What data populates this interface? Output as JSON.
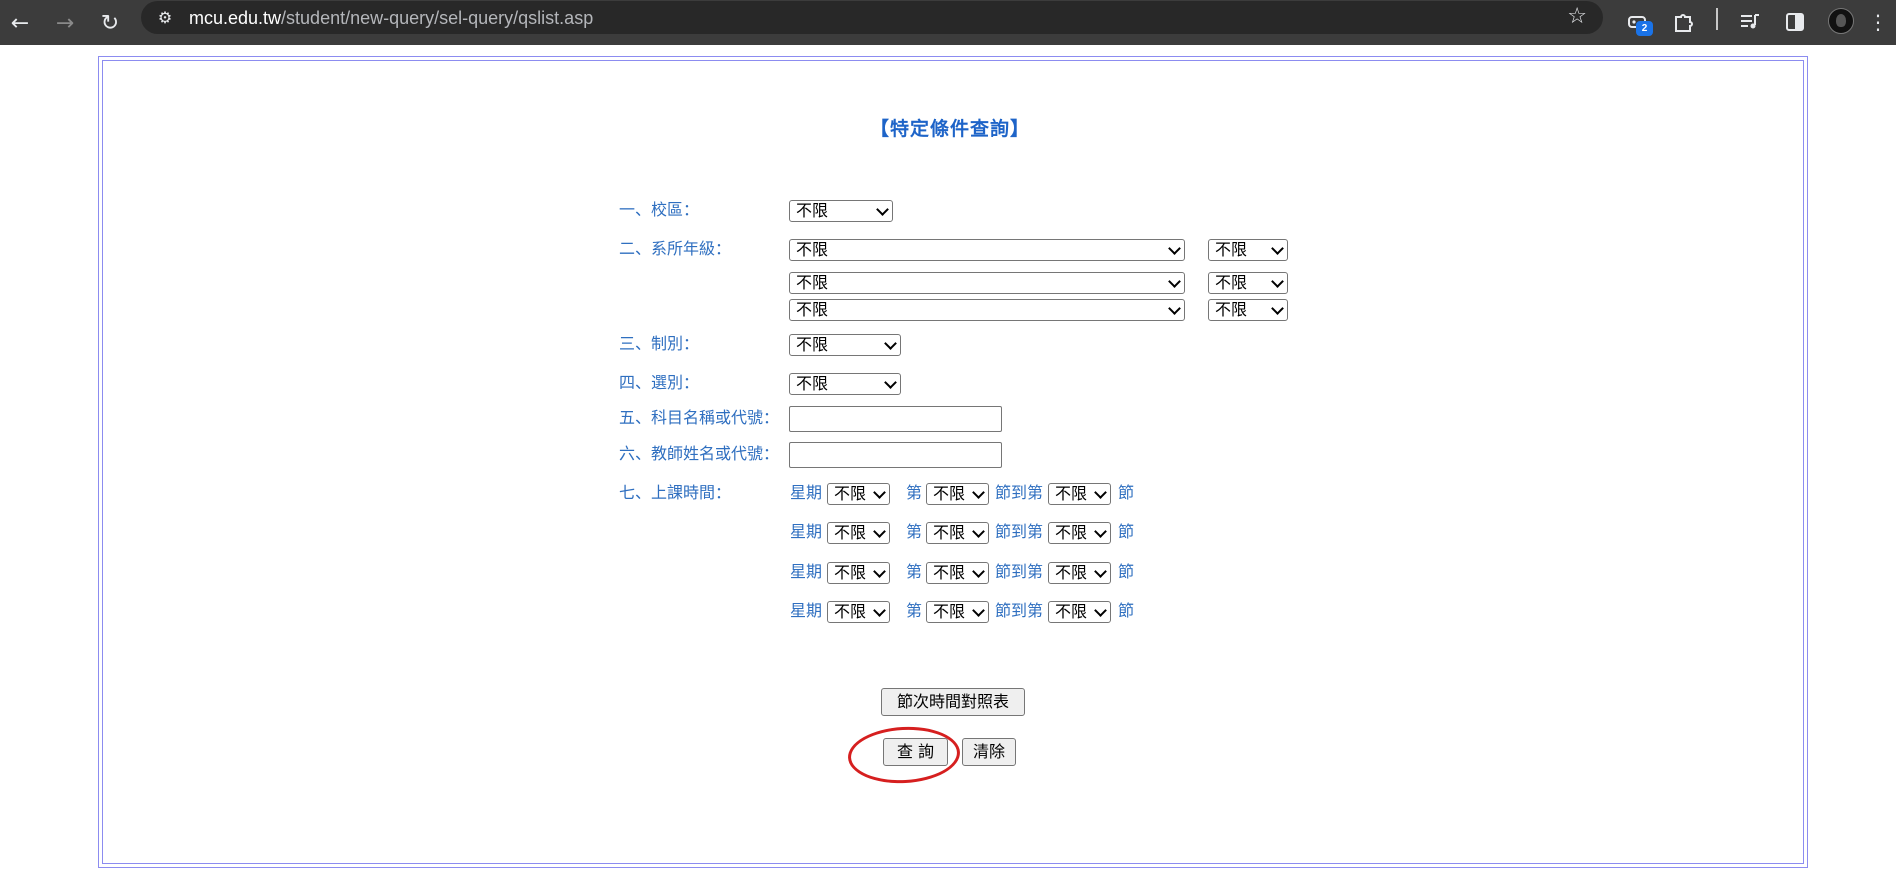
{
  "browser": {
    "url_host": "mcu.edu.tw",
    "url_path": "/student/new-query/sel-query/qslist.asp",
    "extension_badge": "2",
    "icons": [
      "back-arrow-icon",
      "forward-arrow-icon",
      "reload-icon",
      "site-info-icon",
      "bookmark-star-icon",
      "extension-icon",
      "puzzle-icon",
      "media-icon",
      "sidebar-icon",
      "profile-icon"
    ]
  },
  "page": {
    "title": "【特定條件查詢】",
    "fields": {
      "campus_label": "一、校區：",
      "campus_value": "不限",
      "dept_label": "二、系所年級：",
      "dept_rows": [
        {
          "dept": "不限",
          "grade": "不限"
        },
        {
          "dept": "不限",
          "grade": "不限"
        },
        {
          "dept": "不限",
          "grade": "不限"
        }
      ],
      "system_label": "三、制別：",
      "system_value": "不限",
      "type_label": "四、選別：",
      "type_value": "不限",
      "subject_label": "五、科目名稱或代號：",
      "subject_value": "",
      "teacher_label": "六、教師姓名或代號：",
      "teacher_value": "",
      "time_label": "七、上課時間：",
      "time_rows": [
        {
          "weekday": "不限",
          "from": "不限",
          "to": "不限"
        },
        {
          "weekday": "不限",
          "from": "不限",
          "to": "不限"
        },
        {
          "weekday": "不限",
          "from": "不限",
          "to": "不限"
        },
        {
          "weekday": "不限",
          "from": "不限",
          "to": "不限"
        }
      ],
      "word_weekday": "星期",
      "word_from": "第",
      "word_to": "節到第",
      "word_end": "節"
    },
    "buttons": {
      "period_table": "節次時間對照表",
      "search": "查 詢",
      "clear": "清除"
    },
    "annotation_color": "#d61f1f"
  }
}
